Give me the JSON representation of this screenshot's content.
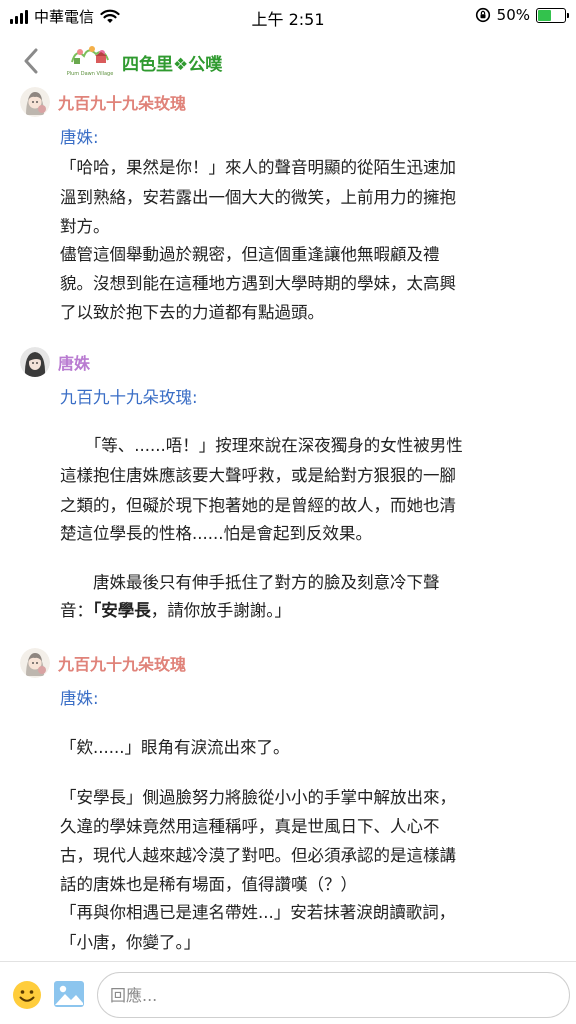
{
  "status_bar": {
    "carrier": "中華電信",
    "time": "上午 2:51",
    "battery_percent": "50%",
    "battery_level": 0.5,
    "battery_color": "#33c24d"
  },
  "header": {
    "back_icon": "chevron-left-icon",
    "board_logo_text": "Plum Dawn Village",
    "board_title": "四色里❖公噗"
  },
  "posts": [
    {
      "author": "九百九十九朵玫瑰",
      "lines": [
        "唐姝:",
        "「哈哈，果然是你！」來人的聲音明顯的從陌生迅速加",
        "溫到熟絡，安若露出一個大大的微笑，上前用力的擁抱",
        "對方。",
        "儘管這個舉動過於親密，但這個重逢讓他無暇顧及禮",
        "貌。沒想到能在這種地方遇到大學時期的學妹，太高興",
        "了以致於抱下去的力道都有點過頭。"
      ]
    },
    {
      "author": "唐姝",
      "lines": [
        "九百九十九朵玫瑰:",
        "　　「等、......唔！」按理來說在深夜獨身的女性被男性",
        "這樣抱住唐姝應該要大聲呼救，或是給對方狠狠的一腳",
        "之類的，但礙於現下抱著她的是曾經的故人，而她也清",
        "楚這位學長的性格......怕是會起到反效果。",
        "　　唐姝最後只有伸手抵住了對方的臉及刻意冷下聲",
        "音：",
        "「安學長",
        "，請你放手謝謝。」"
      ]
    },
    {
      "author": "九百九十九朵玫瑰",
      "lines": [
        "唐姝:",
        "「欸......」眼角有淚流出來了。",
        "「安學長」側過臉努力將臉從小小的手掌中解放出來，",
        "久違的學妹竟然用這種稱呼，真是世風日下、人心不",
        "古，現代人越來越冷漠了對吧。但必須承認的是這樣講",
        "話的唐姝也是稀有場面，值得讚嘆（？）",
        "「再與你相遇已是連名帶姓...」安若抹著淚朗讀歌詞，",
        "「小唐，你變了。」"
      ]
    }
  ],
  "composer": {
    "emoji_icon": "smiley-icon",
    "image_icon": "image-icon",
    "placeholder": "回應..."
  }
}
